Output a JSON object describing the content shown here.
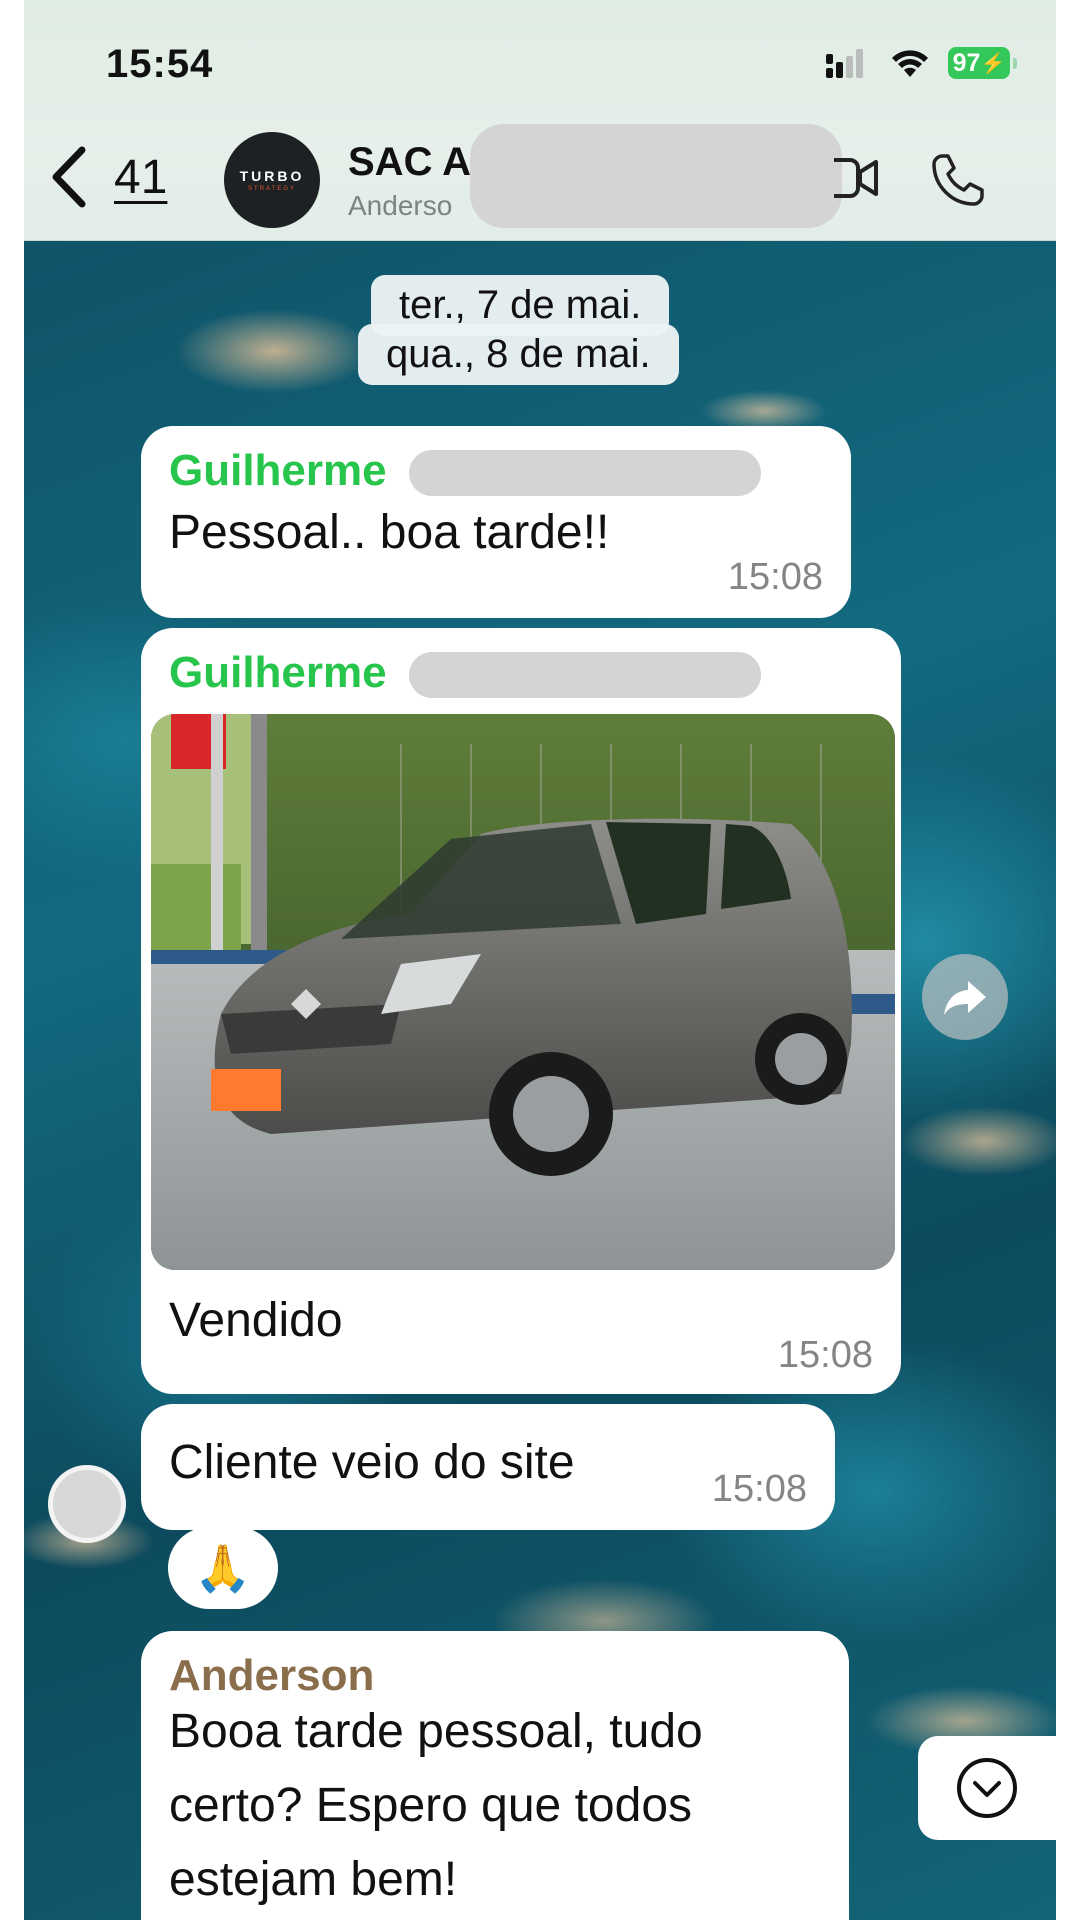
{
  "status_bar": {
    "time": "15:54",
    "battery": "97"
  },
  "header": {
    "back_count": "41",
    "avatar_brand": "TURBO",
    "avatar_brand_sub": "STRATEGY",
    "chat_title": "SAC A",
    "chat_subtitle": "Anderso"
  },
  "dates": {
    "first": "ter., 7 de mai.",
    "second": "qua., 8 de mai."
  },
  "messages": [
    {
      "sender": "Guilherme",
      "text": "Pessoal.. boa tarde!!",
      "time": "15:08"
    },
    {
      "sender": "Guilherme",
      "image": "honda-fit-car-photo",
      "caption": "Vendido",
      "time": "15:08"
    },
    {
      "text": "Cliente veio do site",
      "time": "15:08",
      "reaction": "🙏"
    },
    {
      "sender": "Anderson",
      "text_lines": [
        "Booa tarde pessoal, tudo",
        "certo? Espero que todos",
        "estejam bem!"
      ]
    }
  ],
  "colors": {
    "sender_green": "#27c54c",
    "sender_brown": "#8a6d4a",
    "battery_green": "#34c759"
  },
  "icons": [
    "back-chevron-icon",
    "video-call-icon",
    "phone-call-icon",
    "forward-icon",
    "chevron-down-icon",
    "signal-icon",
    "wifi-icon",
    "battery-icon"
  ]
}
